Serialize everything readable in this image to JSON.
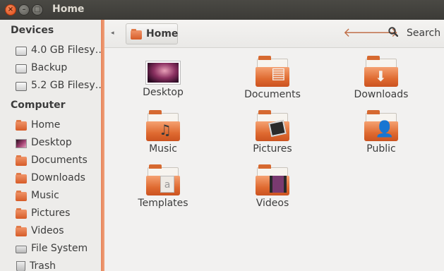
{
  "window": {
    "title": "Home"
  },
  "sidebar": {
    "sections": [
      {
        "label": "Devices",
        "items": [
          {
            "label": "4.0 GB Filesy…",
            "icon": "drive-icon"
          },
          {
            "label": "Backup",
            "icon": "drive-icon"
          },
          {
            "label": "5.2 GB Filesy…",
            "icon": "drive-icon"
          }
        ]
      },
      {
        "label": "Computer",
        "items": [
          {
            "label": "Home",
            "icon": "home-folder-icon"
          },
          {
            "label": "Desktop",
            "icon": "desktop-icon"
          },
          {
            "label": "Documents",
            "icon": "documents-folder-icon"
          },
          {
            "label": "Downloads",
            "icon": "downloads-folder-icon"
          },
          {
            "label": "Music",
            "icon": "music-folder-icon"
          },
          {
            "label": "Pictures",
            "icon": "pictures-folder-icon"
          },
          {
            "label": "Videos",
            "icon": "videos-folder-icon"
          },
          {
            "label": "File System",
            "icon": "filesystem-icon"
          },
          {
            "label": "Trash",
            "icon": "trash-icon"
          }
        ]
      }
    ]
  },
  "toolbar": {
    "breadcrumb": "Home",
    "back_icon": "arrow-left-icon",
    "forward_icon": "arrow-right-icon",
    "search_label": "Search"
  },
  "folders": [
    {
      "label": "Desktop",
      "icon": "desktop-thumbnail"
    },
    {
      "label": "Documents",
      "icon": "documents-folder-icon"
    },
    {
      "label": "Downloads",
      "icon": "downloads-folder-icon"
    },
    {
      "label": "Music",
      "icon": "music-folder-icon"
    },
    {
      "label": "Pictures",
      "icon": "pictures-folder-icon"
    },
    {
      "label": "Public",
      "icon": "public-folder-icon"
    },
    {
      "label": "Templates",
      "icon": "templates-folder-icon"
    },
    {
      "label": "Videos",
      "icon": "videos-folder-icon"
    }
  ],
  "colors": {
    "accent": "#df6a30",
    "titlebar": "#3c3b37",
    "close": "#df4a16"
  }
}
